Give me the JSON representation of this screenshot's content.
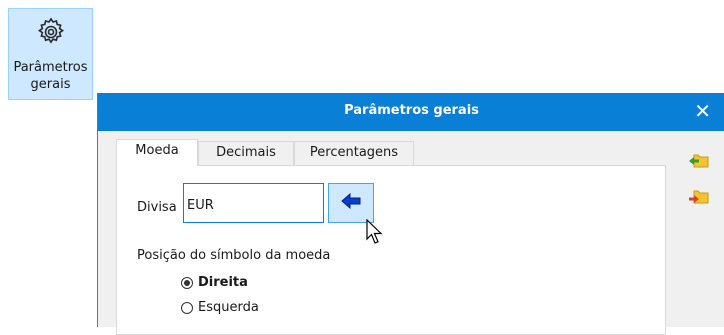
{
  "ribbon": {
    "button_label_line1": "Parâmetros",
    "button_label_line2": "gerais",
    "icon": "gear-icon"
  },
  "dialog": {
    "title": "Parâmetros gerais",
    "close_glyph": "✕"
  },
  "tabs": [
    {
      "label": "Moeda",
      "active": true
    },
    {
      "label": "Decimais",
      "active": false
    },
    {
      "label": "Percentagens",
      "active": false
    }
  ],
  "currency": {
    "label": "Divisa",
    "value": "EUR"
  },
  "symbol_position": {
    "label": "Posição do símbolo da moeda",
    "options": [
      {
        "label": "Direita",
        "selected": true
      },
      {
        "label": "Esquerda",
        "selected": false
      }
    ]
  },
  "colors": {
    "titlebar": "#0a7fd6",
    "ribbon_highlight": "#cde8ff",
    "arrow": "#0a3ecf"
  }
}
